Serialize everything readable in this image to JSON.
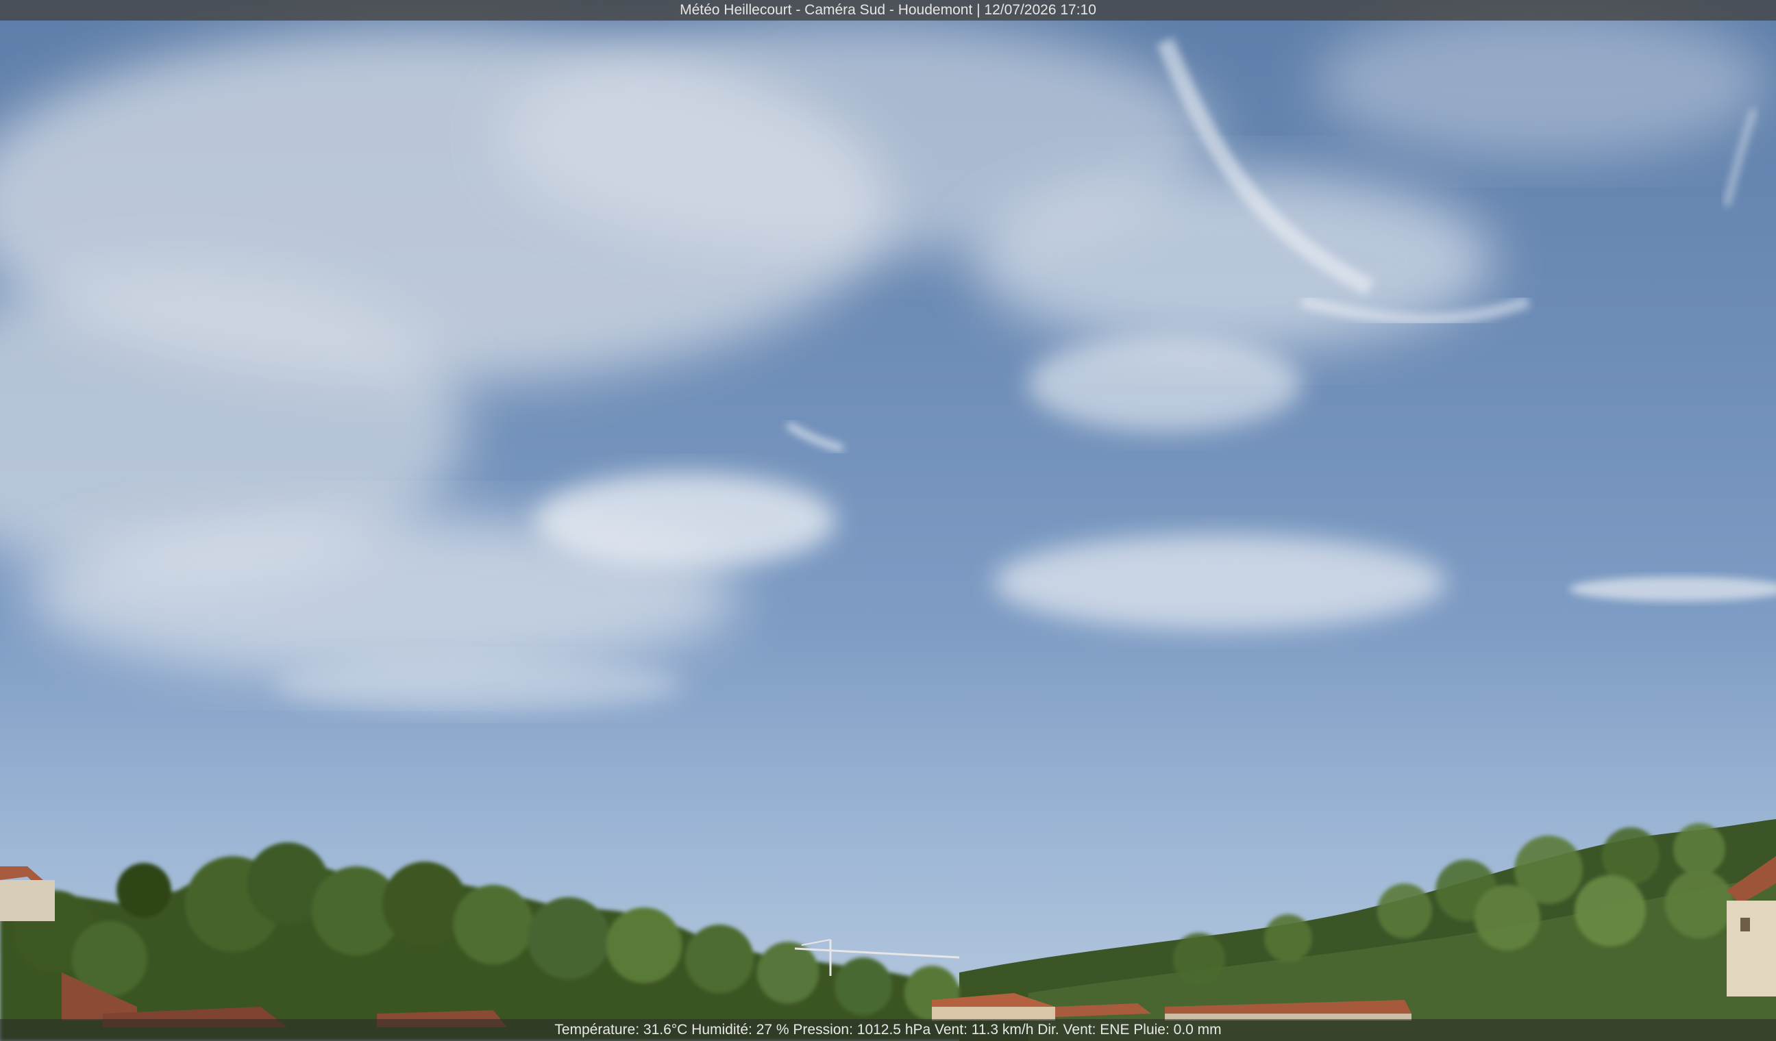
{
  "header": {
    "title": "Météo Heillecourt - Caméra Sud - Houdemont | 12/07/2026 17:10"
  },
  "footer": {
    "status_line": "Température: 31.6°C  Humidité: 27 % Pression: 1012.5 hPa Vent: 11.3 km/h Dir. Vent: ENE Pluie: 0.0 mm"
  },
  "colors": {
    "title_bar": "#464646",
    "sky_top": "#5e7ea9",
    "sky_horizon": "#b7c9de",
    "vegetation": "#3f5a2a",
    "roofs": "#a85a3c"
  }
}
